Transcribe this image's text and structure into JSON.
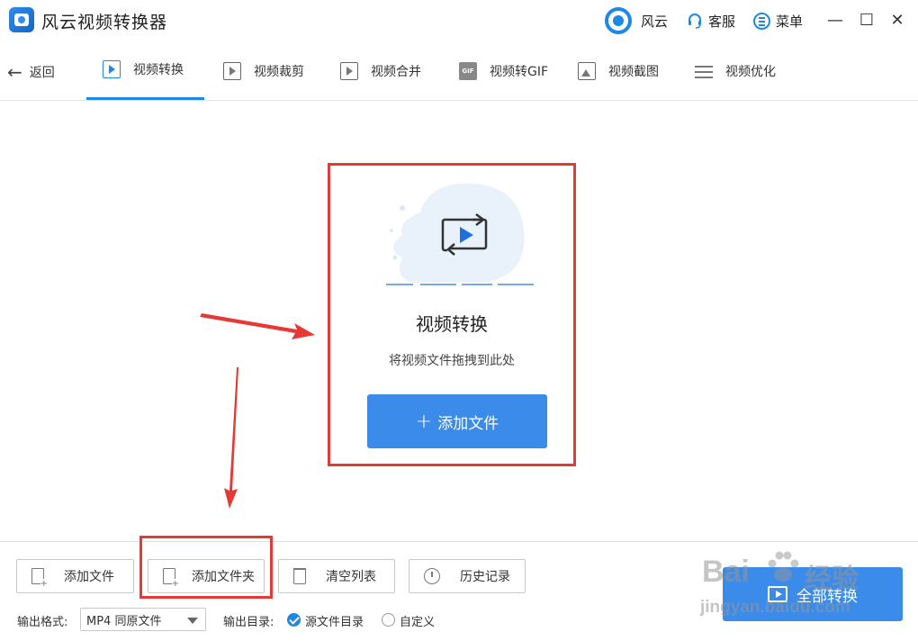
{
  "titlebar": {
    "app_title": "风云视频转换器",
    "brand": "风云",
    "service": "客服",
    "menu": "菜单",
    "minimize": "—",
    "maximize": "☐",
    "close": "✕"
  },
  "nav": {
    "back": "返回",
    "tabs": [
      {
        "label": "视频转换",
        "icon": "video-convert-icon",
        "active": true
      },
      {
        "label": "视频裁剪",
        "icon": "video-crop-icon",
        "active": false
      },
      {
        "label": "视频合并",
        "icon": "video-merge-icon",
        "active": false
      },
      {
        "label": "视频转GIF",
        "icon": "gif-icon",
        "active": false
      },
      {
        "label": "视频截图",
        "icon": "screenshot-icon",
        "active": false
      },
      {
        "label": "视频优化",
        "icon": "optimize-icon",
        "active": false
      }
    ]
  },
  "dropzone": {
    "title": "视频转换",
    "subtitle": "将视频文件拖拽到此处",
    "add_file_label": "添加文件",
    "add_file_symbol": "+"
  },
  "toolbar": {
    "add_file": "添加文件",
    "add_folder": "添加文件夹",
    "clear_list": "清空列表",
    "history": "历史记录"
  },
  "output": {
    "format_label": "输出格式:",
    "format_value": "MP4 同原文件",
    "dir_label": "输出目录:",
    "dir_source": "源文件目录",
    "dir_custom": "自定义",
    "dir_selected": "源文件目录"
  },
  "convert_all": "全部转换",
  "watermark": {
    "brand": "Bai",
    "brand2": "经验",
    "url": "jingyan.baidu.com"
  },
  "colors": {
    "accent": "#1e88e5",
    "button": "#3b8beb",
    "highlight": "#e53935"
  }
}
